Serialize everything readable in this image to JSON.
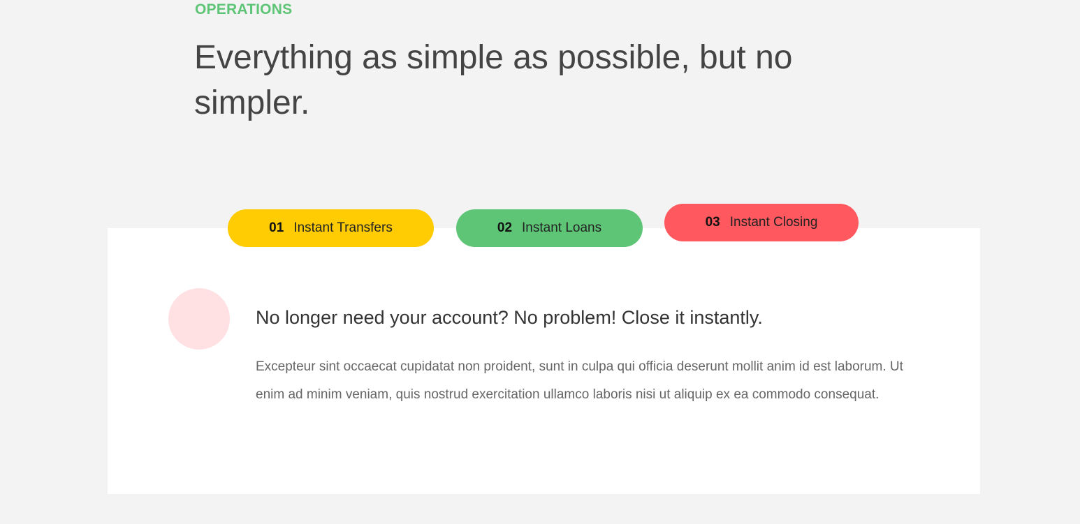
{
  "section": {
    "label": "OPERATIONS",
    "heading": "Everything as simple as possible, but no simpler."
  },
  "tabs": [
    {
      "number": "01",
      "label": "Instant Transfers",
      "color": "#ffcb03"
    },
    {
      "number": "02",
      "label": "Instant Loans",
      "color": "#5ec576"
    },
    {
      "number": "03",
      "label": "Instant Closing",
      "color": "#ff585f",
      "active": true
    }
  ],
  "content": {
    "icon_color": "#ffe1e3",
    "title": "No longer need your account? No problem! Close it instantly.",
    "text": "Excepteur sint occaecat cupidatat non proident, sunt in culpa qui officia deserunt mollit anim id est laborum. Ut enim ad minim veniam, quis nostrud exercitation ullamco laboris nisi ut aliquip ex ea commodo consequat."
  },
  "colors": {
    "accent_green": "#5ec576",
    "background": "#f3f3f3",
    "panel": "#ffffff"
  }
}
